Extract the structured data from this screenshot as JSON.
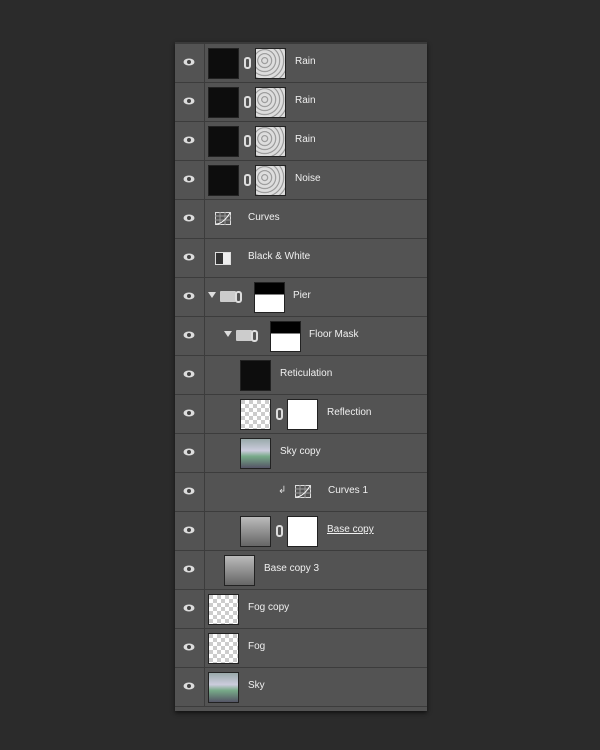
{
  "layers": [
    {
      "name": "Rain",
      "thumb": "dark",
      "mask": "noise",
      "indent": 0,
      "linked": true
    },
    {
      "name": "Rain",
      "thumb": "dark",
      "mask": "noise",
      "indent": 0,
      "linked": true
    },
    {
      "name": "Rain",
      "thumb": "dark",
      "mask": "noise",
      "indent": 0,
      "linked": true
    },
    {
      "name": "Noise",
      "thumb": "dark",
      "mask": "noise",
      "indent": 0,
      "linked": true
    },
    {
      "name": "Curves",
      "type": "curves-adjustment",
      "indent": 0
    },
    {
      "name": "Black & White",
      "type": "bw-adjustment",
      "indent": 0
    },
    {
      "name": "Pier",
      "type": "group",
      "expanded": true,
      "mask": "white",
      "indent": 0,
      "linked": true
    },
    {
      "name": "Floor Mask",
      "type": "group",
      "expanded": true,
      "mask": "white",
      "indent": 1,
      "linked": true
    },
    {
      "name": "Reticulation",
      "thumb": "dark",
      "indent": 2
    },
    {
      "name": "Reflection",
      "thumb": "checker",
      "mask": "white",
      "indent": 2,
      "linked": true
    },
    {
      "name": "Sky copy",
      "thumb": "sky",
      "indent": 2
    },
    {
      "name": "Curves 1",
      "type": "curves-adjustment",
      "clipped": true,
      "indent": 2
    },
    {
      "name": "Base copy",
      "thumb": "gray",
      "mask": "white",
      "indent": 2,
      "linked": true,
      "underlined": true
    },
    {
      "name": "Base copy 3",
      "thumb": "gray",
      "indent": 1
    },
    {
      "name": "Fog copy",
      "thumb": "checker",
      "indent": 0
    },
    {
      "name": "Fog",
      "thumb": "checker",
      "indent": 0
    },
    {
      "name": "Sky",
      "thumb": "sky",
      "indent": 0
    }
  ],
  "colors": {
    "panel": "#535353",
    "background": "#2b2b2b"
  }
}
